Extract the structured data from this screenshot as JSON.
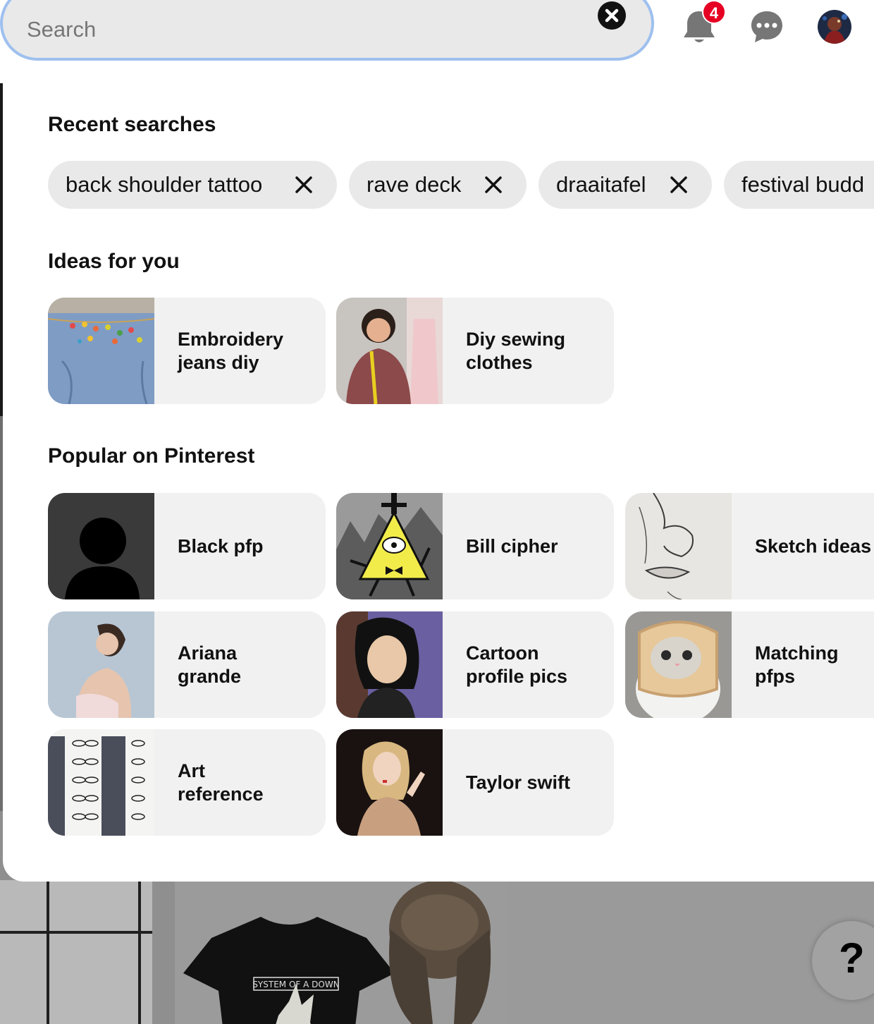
{
  "search": {
    "placeholder": "Search",
    "value": ""
  },
  "header": {
    "notifications_count": "4"
  },
  "recent_searches": {
    "title": "Recent searches",
    "items": [
      "back shoulder tattoo",
      "rave deck",
      "draaitafel",
      "festival budd"
    ]
  },
  "ideas": {
    "title": "Ideas for you",
    "items": [
      "Embroidery\njeans diy",
      "Diy sewing\nclothes"
    ]
  },
  "popular": {
    "title": "Popular on Pinterest",
    "items": [
      "Black pfp",
      "Bill cipher",
      "Sketch ideas",
      "Ariana\ngrande",
      "Cartoon\nprofile pics",
      "Matching\npfps",
      "Art\nreference",
      "Taylor swift"
    ]
  },
  "background": {
    "tshirt_text": "SYSTEM OF A DOWN"
  },
  "help": {
    "label": "?"
  },
  "colors": {
    "focus_ring": "#9ec0ef",
    "badge": "#e60023",
    "chip_bg": "#e9e9e9",
    "card_bg": "#f1f1f1"
  }
}
